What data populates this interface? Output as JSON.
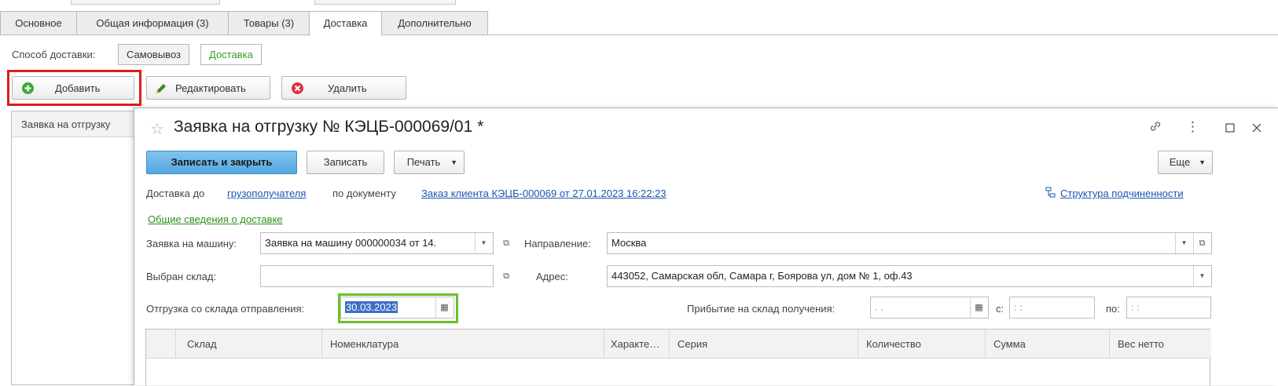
{
  "tabs": [
    {
      "label": "Основное",
      "active": false
    },
    {
      "label": "Общая информация (3)",
      "active": false
    },
    {
      "label": "Товары (3)",
      "active": false
    },
    {
      "label": "Доставка",
      "active": true
    },
    {
      "label": "Дополнительно",
      "active": false
    }
  ],
  "delivery_method": {
    "label": "Способ доставки:",
    "options": [
      "Самовывоз",
      "Доставка"
    ],
    "selected": "Доставка"
  },
  "toolbar": {
    "add_label": "Добавить",
    "edit_label": "Редактировать",
    "delete_label": "Удалить"
  },
  "list": {
    "column_header": "Заявка на отгрузку"
  },
  "modal": {
    "title": "Заявка на отгрузку № КЭЦБ-000069/01 *",
    "buttons": {
      "save_close": "Записать и закрыть",
      "save": "Записать",
      "print": "Печать",
      "more": "Еще"
    },
    "delivery_line": {
      "prefix": "Доставка до",
      "recipient_link": "грузополучателя",
      "by_document": "по документу",
      "document_link": "Заказ клиента КЭЦБ-000069 от 27.01.2023 16:22:23",
      "structure_link": "Структура подчиненности"
    },
    "general_info_link": "Общие сведения о доставке",
    "fields": {
      "vehicle_request_label": "Заявка на машину:",
      "vehicle_request_value": "Заявка на машину 000000034 от 14.",
      "direction_label": "Направление:",
      "direction_value": "Москва",
      "warehouse_label": "Выбран склад:",
      "warehouse_value": "",
      "address_label": "Адрес:",
      "address_value": "443052, Самарская обл, Самара г, Боярова ул, дом № 1, оф.43",
      "shipment_label": "Отгрузка со склада отправления:",
      "shipment_date": "30.03.2023",
      "arrival_label": "Прибытие на склад получения:",
      "arrival_date": " .  .",
      "from_label": "с:",
      "from_time": " :  :",
      "to_label": "по:",
      "to_time": " :  :"
    },
    "table_columns": [
      "Склад",
      "Номенклатура",
      "Характе…",
      "Серия",
      "Количество",
      "Сумма",
      "Вес нетто"
    ]
  },
  "colors": {
    "highlight_border": "#e11b1b",
    "primary_button": "#5aaee3",
    "link": "#1a56b0",
    "green_link": "#2f8f1a",
    "date_focus_border": "#6cbf2a"
  }
}
